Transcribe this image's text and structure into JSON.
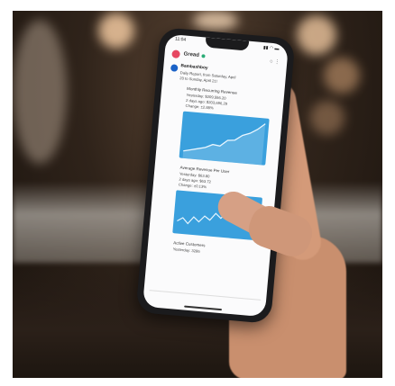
{
  "phone": {
    "status_time": "11:04",
    "status_icons": "▮▮ ◠ ▬",
    "workspace_name": "Gread",
    "topbar_icons": "○ ⋮",
    "bot_name": "Bambashboy",
    "line1": "Daily Report, from Saturday, April",
    "line2": "20 to Sunday, April 21!",
    "card1_title": "Monthly Recurring Revenue",
    "card1_l1": "Yesterday: $209,556.20",
    "card1_l2": "2 days ago: $203,696.29",
    "card1_l3": "Change: ±2.88%",
    "card2_title": "Average Revenue Per User",
    "card2_l1": "Yesterday: $63.80",
    "card2_l2": "2 days ago: $63.72",
    "card2_l3": "Change: ±0.13%",
    "section3": "Active Customers",
    "section3_l1": "Yesterday: 3286"
  },
  "colors": {
    "chart_blue": "#3aa0dd",
    "slack_red": "#e64862",
    "online_green": "#2bac76"
  }
}
